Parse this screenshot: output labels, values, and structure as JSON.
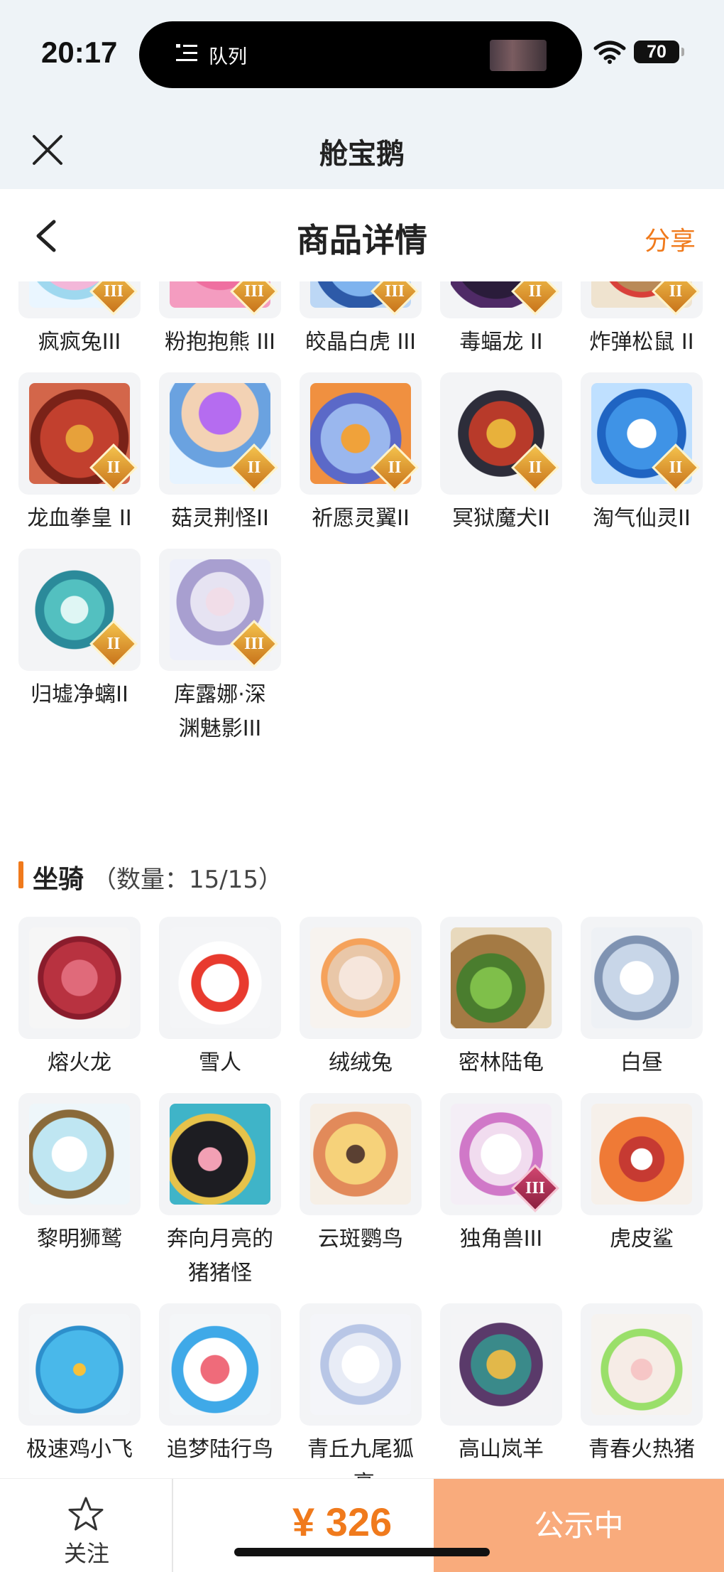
{
  "status_bar": {
    "time": "20:17",
    "activity_label": "队列",
    "battery": "70"
  },
  "mini_program": {
    "title": "舱宝鹅"
  },
  "nav": {
    "title": "商品详情",
    "share": "分享"
  },
  "pets": [
    {
      "name": "疯疯兔III",
      "badge": "III"
    },
    {
      "name": "粉抱抱熊 III",
      "badge": "III"
    },
    {
      "name": "皎晶白虎 III",
      "badge": "III"
    },
    {
      "name": "毒蝠龙 II",
      "badge": "II"
    },
    {
      "name": "炸弹松鼠 II",
      "badge": "II"
    },
    {
      "name": "龙血拳皇 II",
      "badge": "II"
    },
    {
      "name": "菇灵荆怪II",
      "badge": "II"
    },
    {
      "name": "祈愿灵翼II",
      "badge": "II"
    },
    {
      "name": "冥狱魔犬II",
      "badge": "II"
    },
    {
      "name": "淘气仙灵II",
      "badge": "II"
    },
    {
      "name": "归墟净螭II",
      "badge": "II"
    },
    {
      "name": "库露娜·深渊魅影III",
      "name_line1": "库露娜·深",
      "name_line2": "渊魅影III",
      "badge": "III"
    }
  ],
  "mounts_section": {
    "title": "坐骑",
    "count": "（数量：15/15）"
  },
  "mounts": [
    {
      "name": "熔火龙"
    },
    {
      "name": "雪人"
    },
    {
      "name": "绒绒兔"
    },
    {
      "name": "密林陆龟"
    },
    {
      "name": "白昼"
    },
    {
      "name": "黎明狮鹫"
    },
    {
      "name": "奔向月亮的猪猪怪",
      "name_line1": "奔向月亮的",
      "name_line2": "猪猪怪"
    },
    {
      "name": "云斑鹦鸟"
    },
    {
      "name": "独角兽III",
      "badge": "III"
    },
    {
      "name": "虎皮鲨"
    },
    {
      "name": "极速鸡小飞"
    },
    {
      "name": "追梦陆行鸟"
    },
    {
      "name": "青丘九尾狐",
      "name_line2": "·亮"
    },
    {
      "name": "高山岚羊"
    },
    {
      "name": "青春火热猪"
    }
  ],
  "bottom": {
    "follow": "关注",
    "price": "¥ 326",
    "status_button": "公示中"
  },
  "colors": {
    "accent": "#f07a1c",
    "status_button_bg": "#f9ab7c"
  }
}
